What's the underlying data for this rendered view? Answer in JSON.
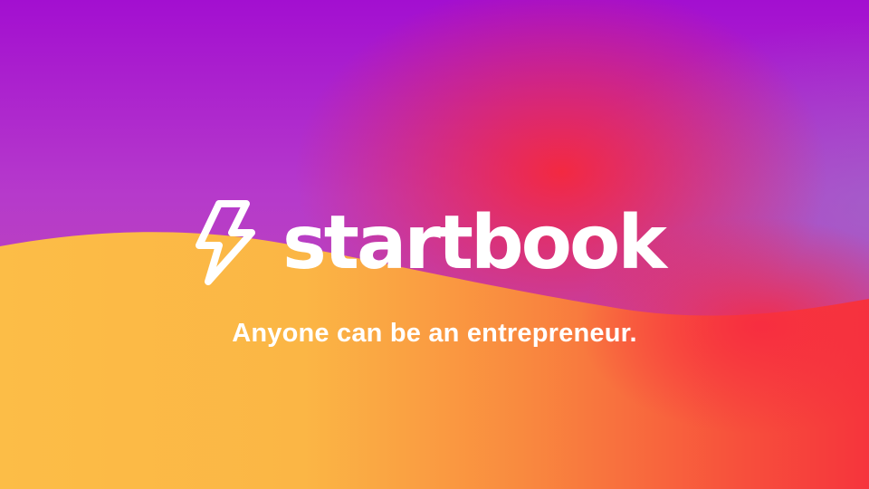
{
  "brand": {
    "name": "startbook",
    "tagline": "Anyone can be an entrepreneur.",
    "logo_icon": "lightning-bolt-icon"
  },
  "colors": {
    "purple": "#a30fd0",
    "red": "#f6283a",
    "orange": "#f8663c",
    "yellow": "#fcba45",
    "text": "#ffffff"
  }
}
